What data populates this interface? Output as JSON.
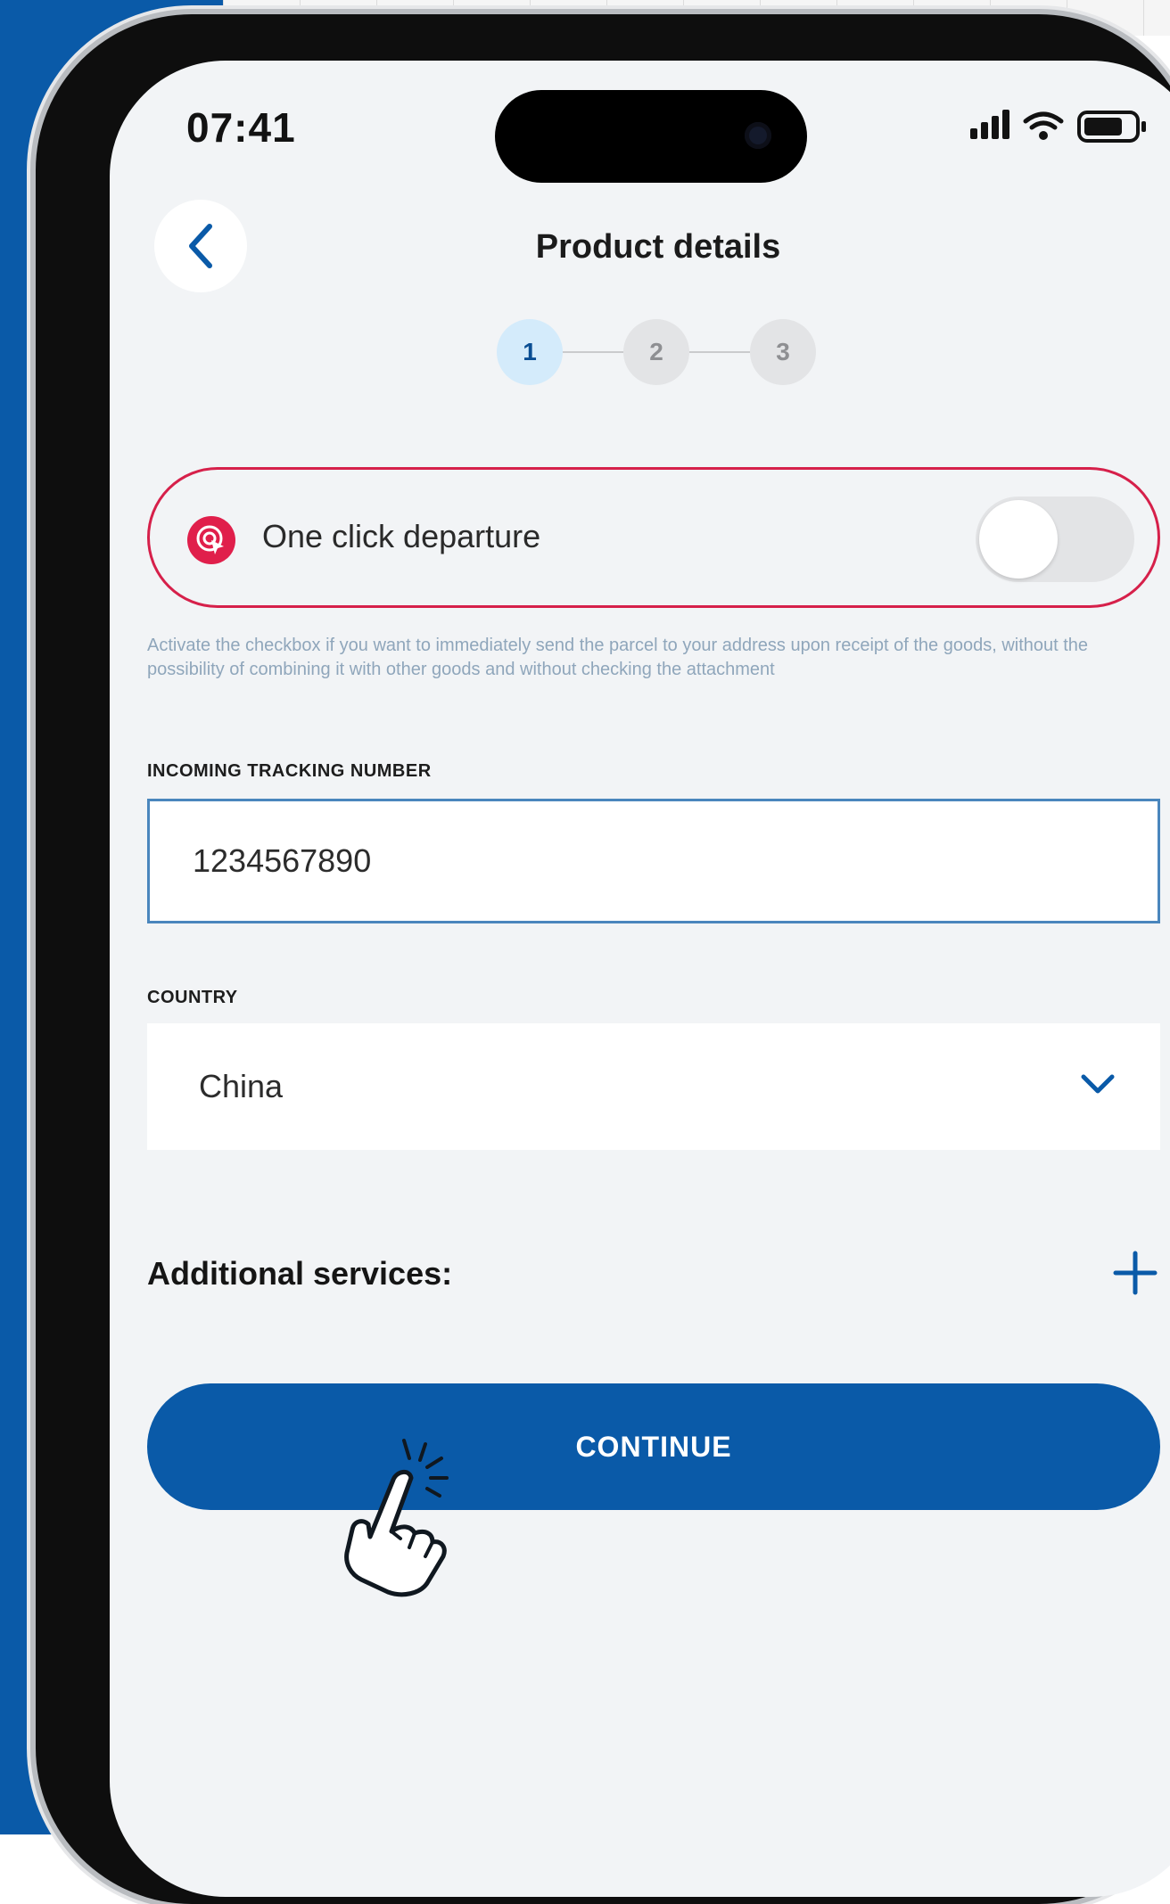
{
  "status_bar": {
    "time": "07:41"
  },
  "header": {
    "title": "Product details"
  },
  "stepper": {
    "steps": [
      "1",
      "2",
      "3"
    ],
    "active_step": 1
  },
  "one_click": {
    "label": "One click departure",
    "enabled": false,
    "hint": "Activate the checkbox if you want to immediately send the parcel to your address upon receipt of the goods, without the possibility of combining it with other goods and without checking the attachment"
  },
  "tracking": {
    "label": "INCOMING TRACKING NUMBER",
    "value": "1234567890"
  },
  "country": {
    "label": "COUNTRY",
    "value": "China"
  },
  "additional_services": {
    "label": "Additional services:"
  },
  "continue_button": {
    "label": "CONTINUE"
  },
  "icons": {
    "back": "chevron-left-icon",
    "one_click": "target-tap-icon",
    "dropdown": "chevron-down-icon",
    "add": "plus-icon",
    "pointer": "hand-pointer-icon"
  },
  "colors": {
    "primary": "#0a5aa8",
    "accent_red": "#d6204a",
    "screen_bg": "#f2f4f6",
    "step_active_bg": "#d4ebfb",
    "hint_text": "#8fa6bb"
  }
}
